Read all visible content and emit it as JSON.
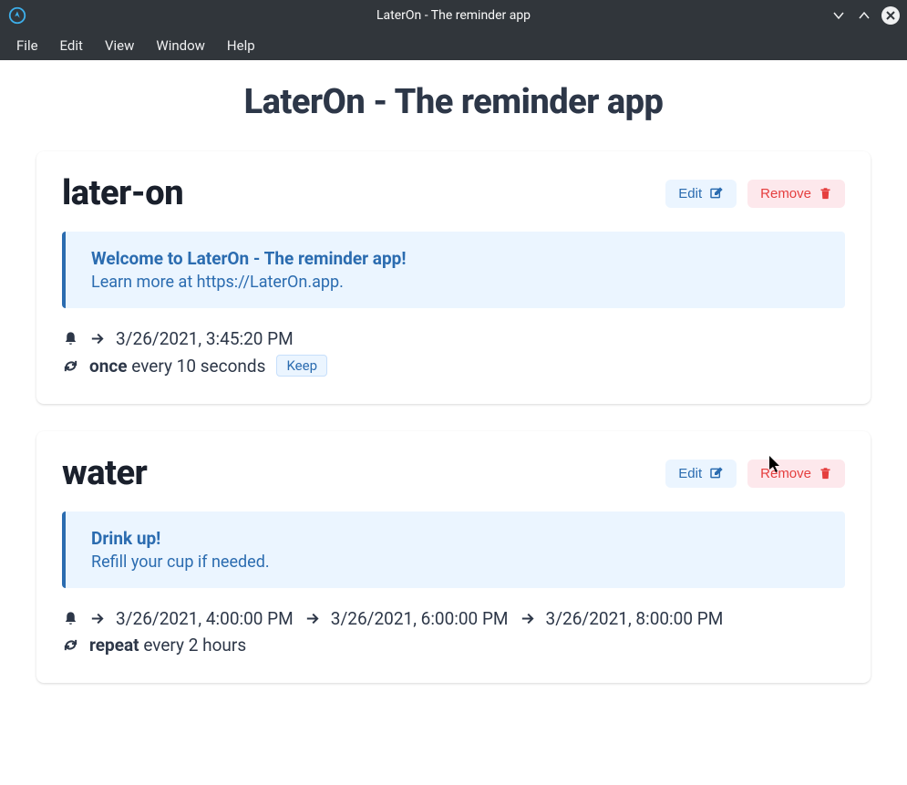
{
  "window": {
    "title": "LaterOn - The reminder app"
  },
  "menu": {
    "file": "File",
    "edit": "Edit",
    "view": "View",
    "window": "Window",
    "help": "Help"
  },
  "page": {
    "title": "LaterOn - The reminder app"
  },
  "actions": {
    "edit": "Edit",
    "remove": "Remove",
    "keep": "Keep"
  },
  "reminders": [
    {
      "name": "later-on",
      "message_title": "Welcome to LaterOn - The reminder app!",
      "message_body": "Learn more at https://LaterOn.app.",
      "times": [
        "3/26/2021, 3:45:20 PM"
      ],
      "freq_mode": "once",
      "freq_detail": "every 10 seconds",
      "keep_badge": true
    },
    {
      "name": "water",
      "message_title": "Drink up!",
      "message_body": "Refill your cup if needed.",
      "times": [
        "3/26/2021, 4:00:00 PM",
        "3/26/2021, 6:00:00 PM",
        "3/26/2021, 8:00:00 PM"
      ],
      "freq_mode": "repeat",
      "freq_detail": "every 2 hours",
      "keep_badge": false
    }
  ]
}
